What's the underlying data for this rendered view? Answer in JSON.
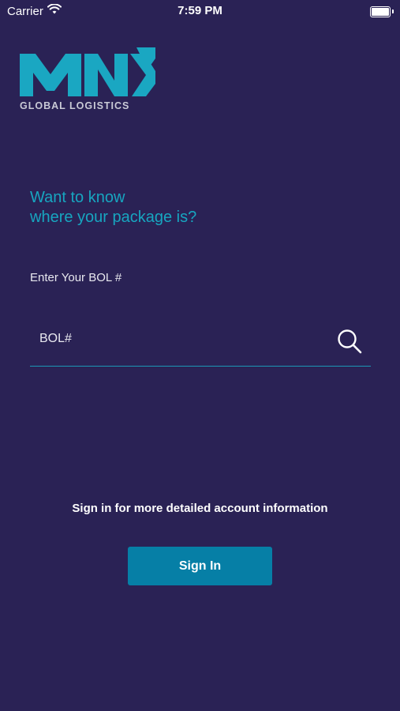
{
  "status_bar": {
    "carrier": "Carrier",
    "time": "7:59 PM"
  },
  "logo": {
    "brand": "MNX",
    "subtitle": "GLOBAL LOGISTICS",
    "color": "#1aa7c2"
  },
  "headline": {
    "line1": "Want to know",
    "line2": "where your package is?"
  },
  "bol": {
    "label": "Enter Your BOL #",
    "placeholder": "BOL#",
    "value": ""
  },
  "signin": {
    "message": "Sign in for more detailed account information",
    "button_label": "Sign In"
  },
  "colors": {
    "background": "#2a2255",
    "accent": "#17a6c0",
    "button": "#067fa6"
  },
  "icons": {
    "wifi": "wifi-icon",
    "battery": "battery-icon",
    "search": "search-icon"
  }
}
